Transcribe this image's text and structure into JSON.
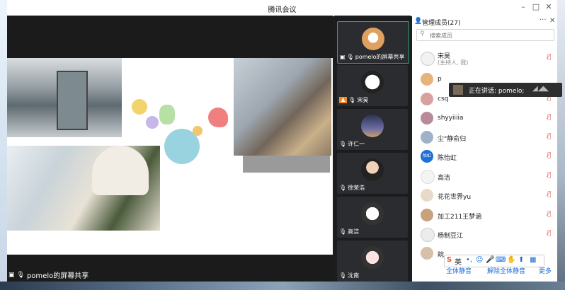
{
  "window": {
    "title": "腾讯会议"
  },
  "share": {
    "label": "pomelo的屏幕共享"
  },
  "videos": [
    {
      "name": "pomelo的屏幕共享",
      "active": true
    },
    {
      "name": "宋昊"
    },
    {
      "name": "许仁一"
    },
    {
      "name": "徐荣浩"
    },
    {
      "name": "高洁"
    },
    {
      "name": "沈南"
    }
  ],
  "panel": {
    "title": "管理成员(27)",
    "search_placeholder": "搜索成员",
    "speaking": "正在讲话: pomelo;",
    "members": [
      {
        "name": "宋昊",
        "sub": "(主持人, 我)",
        "avatar_color": "#f2f2f2"
      },
      {
        "name": "p",
        "avatar_color": "#e8b27a"
      },
      {
        "name": "csq",
        "avatar_color": "#d9a0a0"
      },
      {
        "name": "shyyiiiia",
        "avatar_color": "#b88a9a"
      },
      {
        "name": "尘\"静俞归",
        "avatar_color": "#9fb3c8"
      },
      {
        "name": "陈怡虹",
        "avatar_color": "#1f6fd6",
        "avatar_text": "怡虹"
      },
      {
        "name": "高洁",
        "avatar_color": "#f4f4f4"
      },
      {
        "name": "花花世界yu",
        "avatar_color": "#e9d9c9"
      },
      {
        "name": "加工211王梦涵",
        "avatar_color": "#c7a27c"
      },
      {
        "name": "杨制豆江",
        "avatar_color": "#ececec"
      },
      {
        "name": "皖",
        "avatar_color": "#d8c0a8"
      }
    ],
    "buttons": {
      "mute_all": "全体静音",
      "unmute_all": "解除全体静音",
      "more": "更多"
    }
  },
  "ime": {
    "label": "英"
  },
  "colors": {
    "accent": "#1a6ad8",
    "active_border": "#36a36b",
    "mute": "#e05a5a"
  }
}
